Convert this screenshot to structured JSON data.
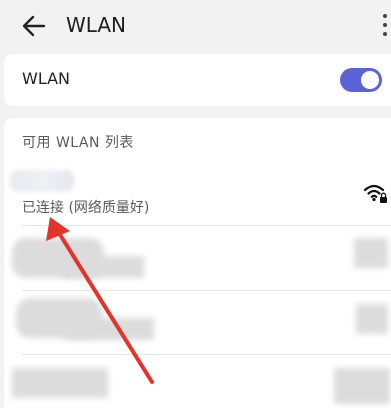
{
  "header": {
    "title": "WLAN"
  },
  "wlan_switch": {
    "label": "WLAN",
    "state": "on",
    "on_color": "#5b63d6"
  },
  "list": {
    "title": "可用 WLAN 列表",
    "connected": {
      "status": "已连接 (网络质量好)"
    },
    "icons": [
      "back-arrow-icon",
      "more-vertical-icon",
      "wifi-locked-icon"
    ]
  },
  "annotation_color": "#e5332a"
}
